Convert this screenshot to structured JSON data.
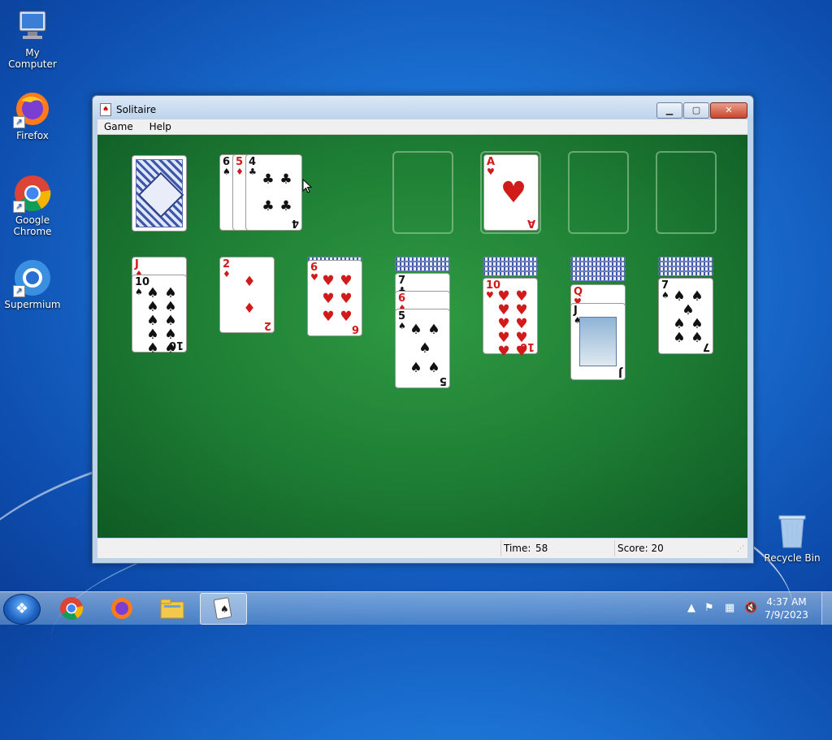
{
  "desktop": {
    "icons": [
      {
        "label": "My Computer",
        "icon": "computer-icon"
      },
      {
        "label": "Firefox",
        "icon": "firefox-icon"
      },
      {
        "label": "Google Chrome",
        "icon": "chrome-icon"
      },
      {
        "label": "Supermium",
        "icon": "supermium-icon"
      },
      {
        "label": "Recycle Bin",
        "icon": "recycle-bin-icon"
      }
    ]
  },
  "window": {
    "title": "Solitaire",
    "controls": {
      "minimize": "▁",
      "maximize": "▢",
      "close": "✕"
    },
    "menu": [
      "Game",
      "Help"
    ],
    "status": {
      "time_label": "Time:",
      "time_value": "58",
      "score_label": "Score: 20"
    }
  },
  "board": {
    "waste": [
      {
        "rank": "6",
        "suit": "♠",
        "color": "black"
      },
      {
        "rank": "5",
        "suit": "♦",
        "color": "red"
      },
      {
        "rank": "4",
        "suit": "♣",
        "color": "black"
      }
    ],
    "foundations": [
      {
        "empty": true
      },
      {
        "rank": "A",
        "suit": "♥",
        "color": "red"
      },
      {
        "empty": true
      },
      {
        "empty": true
      }
    ],
    "tableau": [
      {
        "hidden": 0,
        "cards": [
          {
            "rank": "J",
            "suit": "♦"
          },
          {
            "rank": "10",
            "suit": "♠"
          }
        ]
      },
      {
        "hidden": 0,
        "cards": [
          {
            "rank": "2",
            "suit": "♦"
          }
        ]
      },
      {
        "hidden": 0,
        "cards": [
          {
            "rank": "6",
            "suit": "♥"
          }
        ]
      },
      {
        "hidden": 3,
        "cards": [
          {
            "rank": "7",
            "suit": "♣"
          },
          {
            "rank": "6",
            "suit": "♦"
          },
          {
            "rank": "5",
            "suit": "♠"
          }
        ]
      },
      {
        "hidden": 4,
        "cards": [
          {
            "rank": "10",
            "suit": "♥"
          }
        ]
      },
      {
        "hidden": 5,
        "cards": [
          {
            "rank": "Q",
            "suit": "♥"
          },
          {
            "rank": "J",
            "suit": "♠"
          }
        ]
      },
      {
        "hidden": 6,
        "cards": [
          {
            "rank": "7",
            "suit": "♠"
          }
        ]
      }
    ]
  },
  "taskbar": {
    "apps": [
      "chrome-icon",
      "firefox-icon",
      "file-explorer-icon",
      "solitaire-icon"
    ],
    "time": "4:37 AM",
    "date": "7/9/2023"
  }
}
